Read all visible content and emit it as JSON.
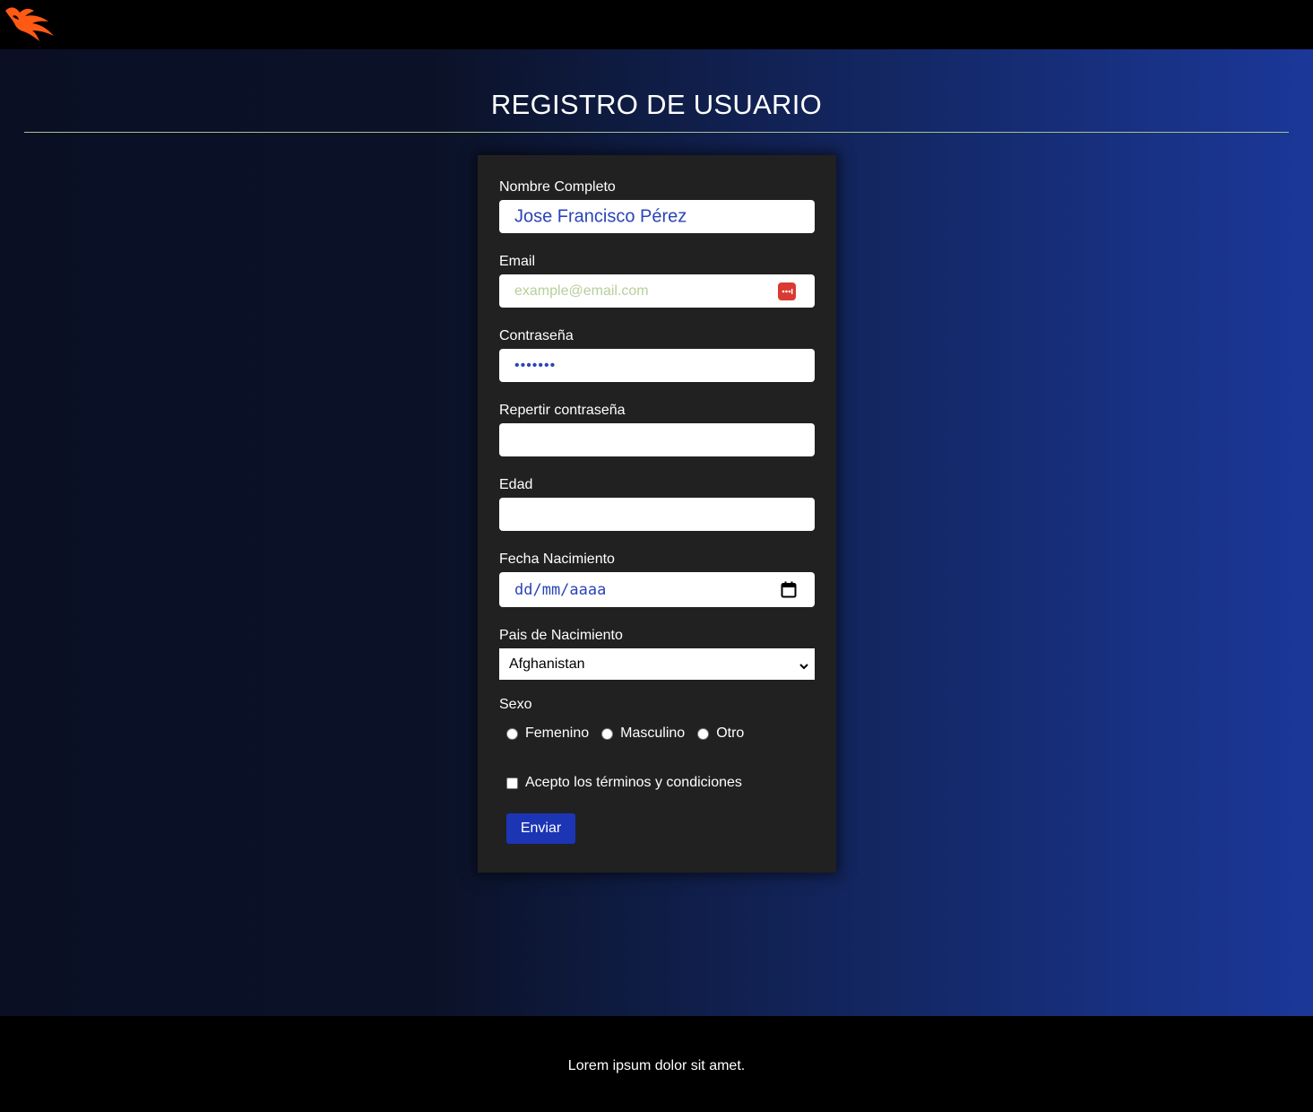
{
  "header": {
    "logo": "phoenix-logo-icon"
  },
  "page": {
    "title": "REGISTRO DE USUARIO"
  },
  "form": {
    "name": {
      "label": "Nombre Completo",
      "value": "Jose Francisco Pérez"
    },
    "email": {
      "label": "Email",
      "placeholder": "example@email.com",
      "icon": "password-manager-icon"
    },
    "password": {
      "label": "Contraseña",
      "value": "•••••••"
    },
    "repeat_password": {
      "label": "Repertir contraseña",
      "value": ""
    },
    "age": {
      "label": "Edad",
      "value": ""
    },
    "birth_date": {
      "label": "Fecha Nacimiento",
      "placeholder": "dd/mm/aaaa",
      "icon": "calendar-icon"
    },
    "country": {
      "label": "Pais de Nacimiento",
      "selected": "Afghanistan"
    },
    "sex": {
      "label": "Sexo",
      "options": [
        "Femenino",
        "Masculino",
        "Otro"
      ]
    },
    "terms": {
      "label": "Acepto los términos y condiciones"
    },
    "submit_label": "Enviar"
  },
  "footer": {
    "text": "Lorem ipsum dolor sit amet."
  },
  "colors": {
    "accent": "#1c35b5",
    "input_text": "#2a44b8",
    "placeholder": "#b7cf9a",
    "card_bg": "#212121",
    "logo": "#ff5a14",
    "divider": "#a8c28e"
  }
}
